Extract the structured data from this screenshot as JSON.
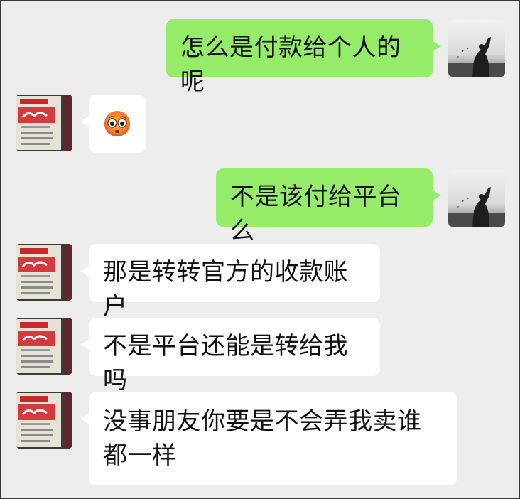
{
  "chat": {
    "messages": [
      {
        "side": "sent",
        "type": "text",
        "text": "怎么是付款给个人的呢"
      },
      {
        "side": "received",
        "type": "emoji",
        "emoji": "flushed-face-icon"
      },
      {
        "side": "sent",
        "type": "text",
        "text": "不是该付给平台么"
      },
      {
        "side": "received",
        "type": "text",
        "text": "那是转转官方的收款账户"
      },
      {
        "side": "received",
        "type": "text",
        "text": "不是平台还能是转给我吗"
      },
      {
        "side": "received",
        "type": "text",
        "text": "没事朋友你要是不会弄我卖谁都一样"
      }
    ]
  },
  "colors": {
    "background": "#ededed",
    "sent_bubble": "#95ec69",
    "received_bubble": "#ffffff"
  },
  "avatars": {
    "sender": "silhouette-photo-avatar",
    "receiver": "cigarette-pack-avatar"
  }
}
